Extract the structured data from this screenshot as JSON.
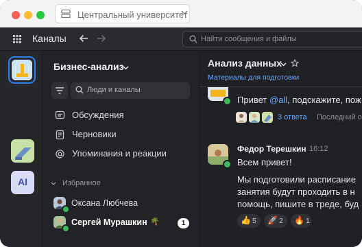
{
  "window": {
    "workspace_title": "Центральный университет"
  },
  "topnav": {
    "title": "Каналы",
    "search_placeholder": "Найти сообщения и файлы"
  },
  "rail": {
    "ai_label": "AI"
  },
  "sidebar": {
    "workspace_name": "Бизнес-анализ",
    "search_placeholder": "Люди и каналы",
    "items": [
      {
        "label": "Обсуждения",
        "icon": "chat-icon"
      },
      {
        "label": "Черновики",
        "icon": "draft-icon"
      },
      {
        "label": "Упоминания и реакции",
        "icon": "at-icon"
      }
    ],
    "favorites_label": "Избранное",
    "favorites": [
      {
        "name": "Оксана Любчева",
        "bold": false
      },
      {
        "name": "Сергей Мурашкин",
        "bold": true,
        "status_emoji": "🌴",
        "unread": "1"
      }
    ]
  },
  "channel": {
    "title": "Анализ данных",
    "link": "Материалы для подготовки",
    "messages": [
      {
        "text_before": "Привет ",
        "mention": "@all",
        "text_after": ", подскажите, пож",
        "replies": "3 ответа",
        "last": "Последний о"
      },
      {
        "author": "Федор Терешкин",
        "time": "16:12",
        "lines": [
          "Всем привет!",
          "Мы подготовили расписание",
          "занятия будут проходить в н",
          "помощь, пишите в треде, буд"
        ],
        "reactions": [
          {
            "emoji": "👍",
            "count": "5"
          },
          {
            "emoji": "🚀",
            "count": "2"
          },
          {
            "emoji": "🔥",
            "count": "1"
          }
        ]
      }
    ]
  },
  "colors": {
    "accent": "#2f80ed",
    "link": "#6aa8ff",
    "presence": "#3cba5a",
    "background": "#202124"
  }
}
